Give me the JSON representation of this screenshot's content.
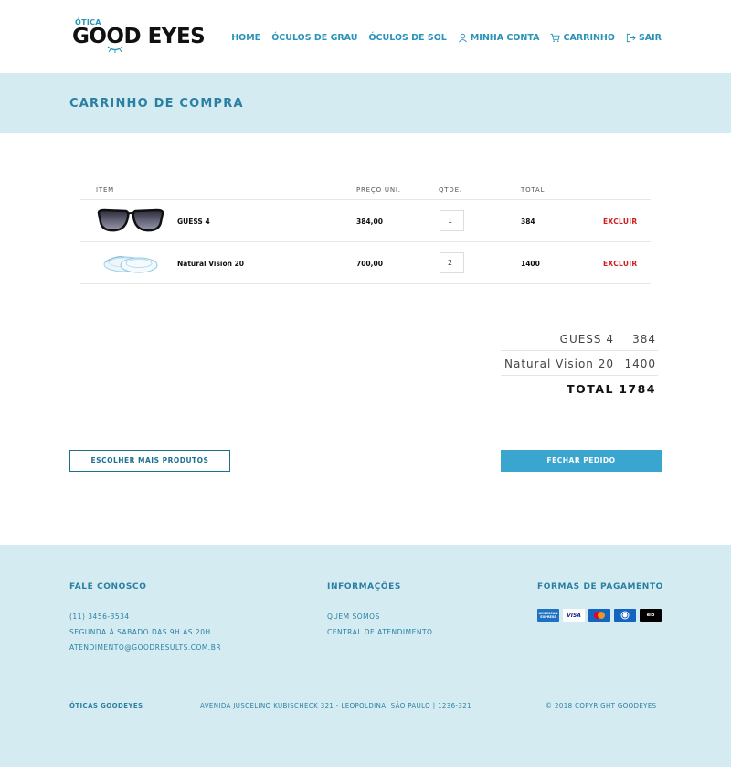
{
  "brand": {
    "small": "ÓTICA",
    "main": "GOOD EYES"
  },
  "nav": [
    {
      "label": "HOME",
      "icon": ""
    },
    {
      "label": "ÓCULOS DE GRAU",
      "icon": ""
    },
    {
      "label": "ÓCULOS DE SOL",
      "icon": ""
    },
    {
      "label": "MINHA CONTA",
      "icon": "user-icon"
    },
    {
      "label": "CARRINHO",
      "icon": "cart-icon"
    },
    {
      "label": "SAIR",
      "icon": "logout-icon"
    }
  ],
  "page_title": "CARRINHO DE COMPRA",
  "table": {
    "headers": {
      "item": "ITEM",
      "price": "PREÇO UNI.",
      "qty": "QTDE.",
      "total": "TOTAL"
    },
    "rows": [
      {
        "name": "GUESS 4",
        "price": "384,00",
        "qty": "1",
        "total": "384",
        "remove": "EXCLUIR",
        "image": "sunglasses"
      },
      {
        "name": "Natural Vision 20",
        "price": "700,00",
        "qty": "2",
        "total": "1400",
        "remove": "EXCLUIR",
        "image": "contact-lenses"
      }
    ]
  },
  "summary": {
    "lines": [
      {
        "name": "GUESS 4",
        "value": "384"
      },
      {
        "name": "Natural Vision 20",
        "value": "1400"
      }
    ],
    "total_label": "TOTAL",
    "total_value": "1784"
  },
  "buttons": {
    "more": "ESCOLHER MAIS PRODUTOS",
    "close": "FECHAR PEDIDO"
  },
  "footer": {
    "contact": {
      "heading": "FALE CONOSCO",
      "phone": "(11) 3456-3534",
      "hours": "SEGUNDA À SABADO DAS 9H AS 20H",
      "email": "ATENDIMENTO@GOODRESULTS.COM.BR"
    },
    "info": {
      "heading": "INFORMAÇÕES",
      "links": [
        "QUEM SOMOS",
        "CENTRAL DE ATENDIMENTO"
      ]
    },
    "payment": {
      "heading": "FORMAS DE PAGAMENTO",
      "cards": [
        {
          "name": "amex",
          "label": "AMERICAN EXPRESS"
        },
        {
          "name": "visa",
          "label": "VISA"
        },
        {
          "name": "mastercard",
          "label": ""
        },
        {
          "name": "diners",
          "label": ""
        },
        {
          "name": "elo",
          "label": "elo"
        }
      ]
    },
    "bottom": {
      "company": "ÓTICAS GOODEYES",
      "address": "AVENIDA JUSCELINO KUBISCHECK 321 - LEOPOLDINA, SÃO PAULO | 1236-321",
      "copyright": "© 2018 COPYRIGHT GOODEYES"
    }
  },
  "colors": {
    "accent": "#2a93b8",
    "band": "#d4ecf1",
    "danger": "#cc1f1f",
    "button": "#3aa6cf"
  }
}
